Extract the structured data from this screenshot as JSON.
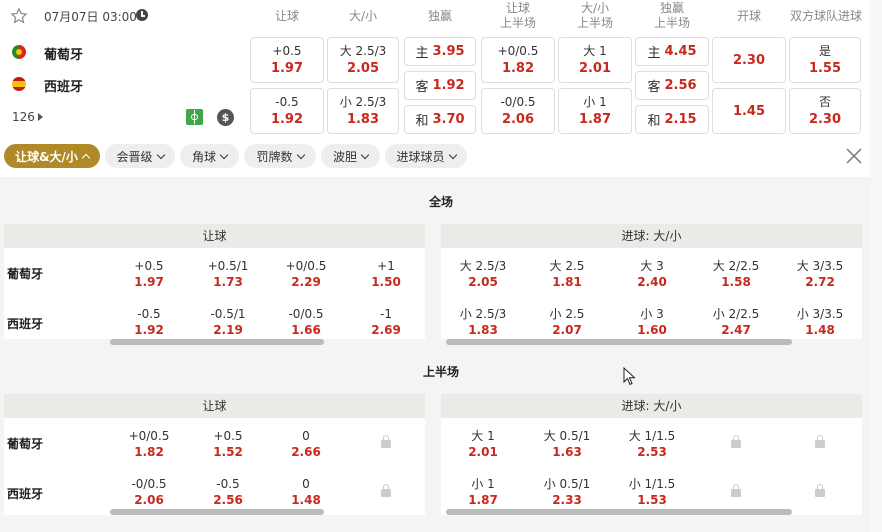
{
  "header": {
    "date": "07月07日 03:00",
    "columns": [
      "让球",
      "大/小",
      "独赢",
      "让球\n上半场",
      "大/小\n上半场",
      "独赢\n上半场",
      "开球",
      "双方球队进球"
    ]
  },
  "teams": {
    "home": "葡萄牙",
    "away": "西班牙",
    "more": "126"
  },
  "main_odds": {
    "hc": [
      {
        "l": "+0.5",
        "v": "1.97"
      },
      {
        "l": "-0.5",
        "v": "1.92"
      }
    ],
    "ou": [
      {
        "l": "大 2.5/3",
        "v": "2.05"
      },
      {
        "l": "小 2.5/3",
        "v": "1.83"
      }
    ],
    "mw": [
      {
        "l": "主",
        "v": "3.95"
      },
      {
        "l": "客",
        "v": "1.92"
      },
      {
        "l": "和",
        "v": "3.70"
      }
    ],
    "hc1": [
      {
        "l": "+0/0.5",
        "v": "1.82"
      },
      {
        "l": "-0/0.5",
        "v": "2.06"
      }
    ],
    "ou1": [
      {
        "l": "大 1",
        "v": "2.01"
      },
      {
        "l": "小 1",
        "v": "1.87"
      }
    ],
    "mw1": [
      {
        "l": "主",
        "v": "4.45"
      },
      {
        "l": "客",
        "v": "2.56"
      },
      {
        "l": "和",
        "v": "2.15"
      }
    ],
    "ko": [
      "2.30",
      "1.45"
    ],
    "btts": [
      {
        "l": "是",
        "v": "1.55"
      },
      {
        "l": "否",
        "v": "2.30"
      }
    ]
  },
  "filters": [
    "让球&大/小",
    "会晋级",
    "角球",
    "罚牌数",
    "波胆",
    "进球球员"
  ],
  "sections": {
    "full": {
      "title": "全场",
      "hc_title": "让球",
      "ou_title": "进球: 大/小",
      "hc_home": [
        {
          "l": "+0.5",
          "v": "1.97"
        },
        {
          "l": "+0.5/1",
          "v": "1.73"
        },
        {
          "l": "+0/0.5",
          "v": "2.29"
        },
        {
          "l": "+1",
          "v": "1.50"
        }
      ],
      "hc_away": [
        {
          "l": "-0.5",
          "v": "1.92"
        },
        {
          "l": "-0.5/1",
          "v": "2.19"
        },
        {
          "l": "-0/0.5",
          "v": "1.66"
        },
        {
          "l": "-1",
          "v": "2.69"
        }
      ],
      "ou_home": [
        {
          "l": "大 2.5/3",
          "v": "2.05"
        },
        {
          "l": "大 2.5",
          "v": "1.81"
        },
        {
          "l": "大 3",
          "v": "2.40"
        },
        {
          "l": "大 2/2.5",
          "v": "1.58"
        },
        {
          "l": "大 3/3.5",
          "v": "2.72"
        }
      ],
      "ou_away": [
        {
          "l": "小 2.5/3",
          "v": "1.83"
        },
        {
          "l": "小 2.5",
          "v": "2.07"
        },
        {
          "l": "小 3",
          "v": "1.60"
        },
        {
          "l": "小 2/2.5",
          "v": "2.47"
        },
        {
          "l": "小 3/3.5",
          "v": "1.48"
        }
      ]
    },
    "half": {
      "title": "上半场",
      "hc_title": "让球",
      "ou_title": "进球: 大/小",
      "hc_home": [
        {
          "l": "+0/0.5",
          "v": "1.82"
        },
        {
          "l": "+0.5",
          "v": "1.52"
        },
        {
          "l": "0",
          "v": "2.66"
        }
      ],
      "hc_away": [
        {
          "l": "-0/0.5",
          "v": "2.06"
        },
        {
          "l": "-0.5",
          "v": "2.56"
        },
        {
          "l": "0",
          "v": "1.48"
        }
      ],
      "ou_home": [
        {
          "l": "大 1",
          "v": "2.01"
        },
        {
          "l": "大 0.5/1",
          "v": "1.63"
        },
        {
          "l": "大 1/1.5",
          "v": "2.53"
        }
      ],
      "ou_away": [
        {
          "l": "小 1",
          "v": "1.87"
        },
        {
          "l": "小 0.5/1",
          "v": "2.33"
        },
        {
          "l": "小 1/1.5",
          "v": "1.53"
        }
      ]
    }
  },
  "colors": {
    "accent": "#b08a28",
    "odds": "#c8281e",
    "panel_header": "#eceae6"
  }
}
